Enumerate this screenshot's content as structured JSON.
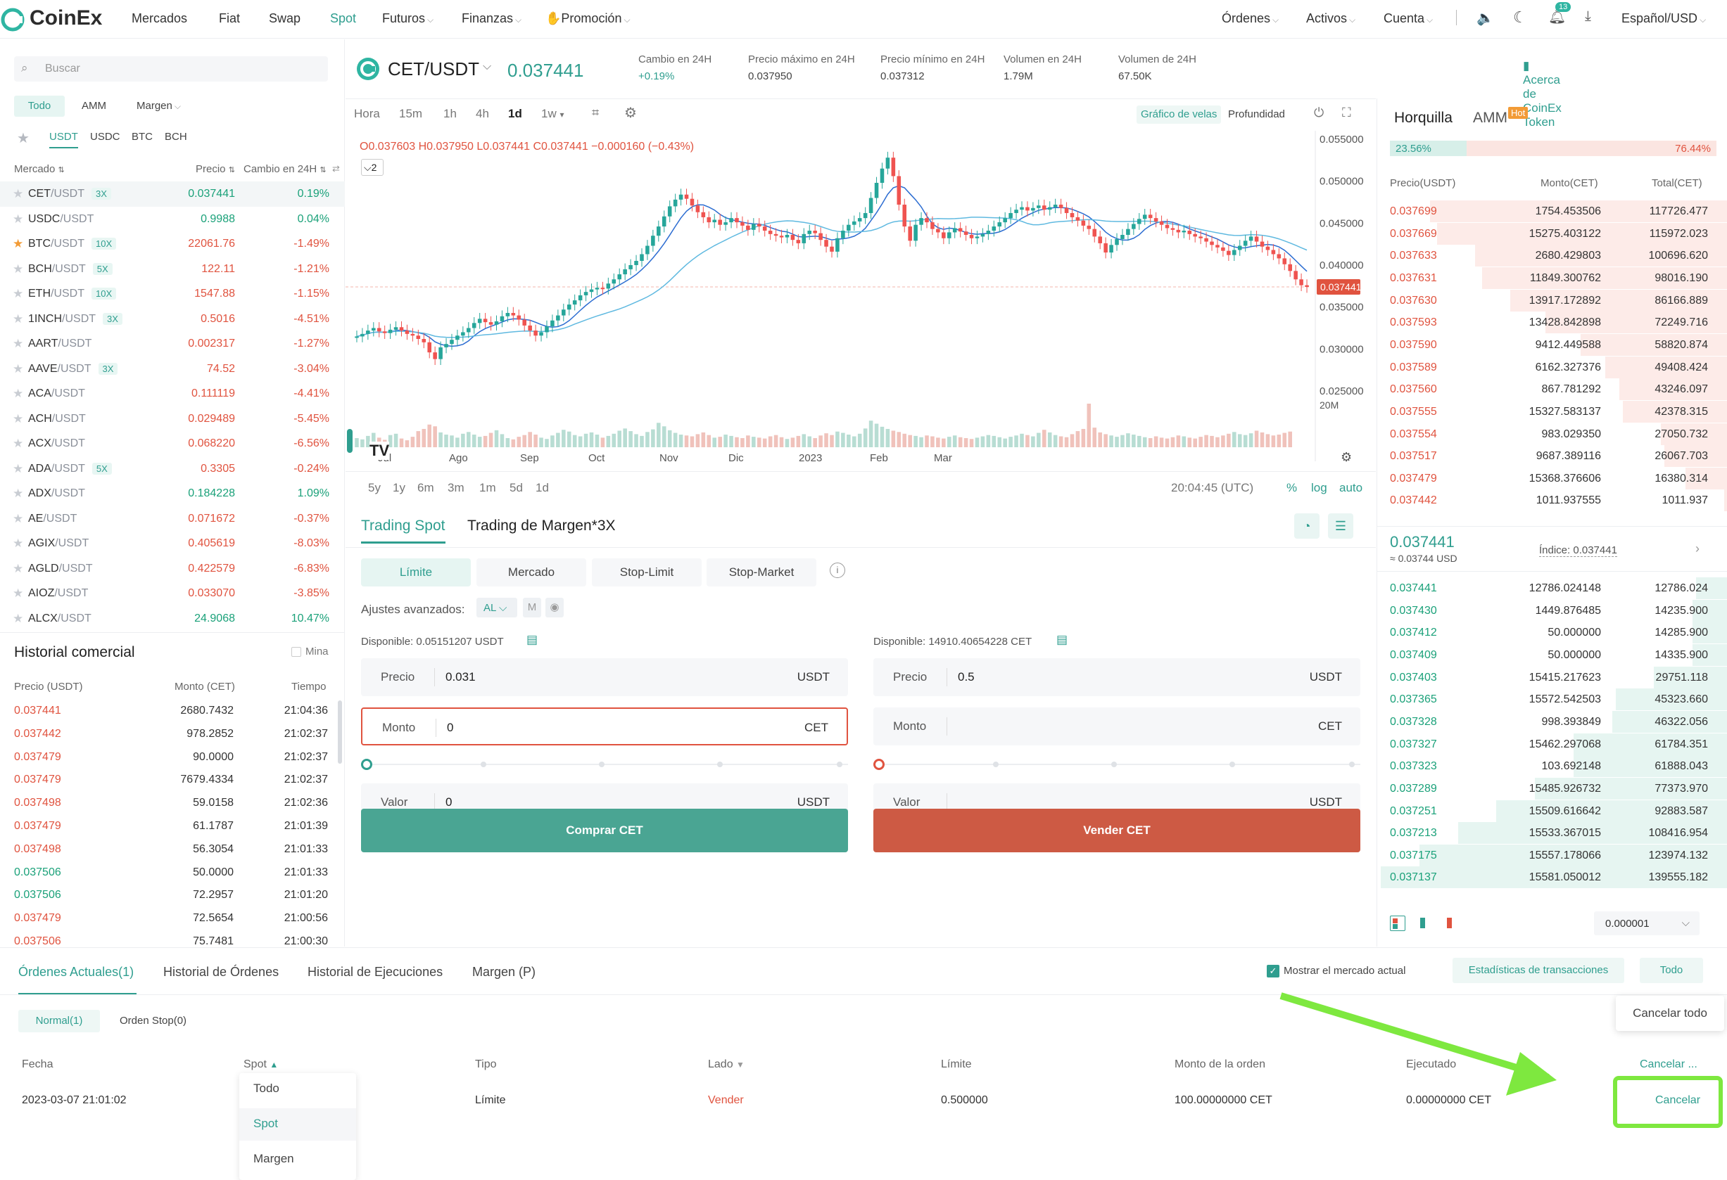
{
  "nav": {
    "brand": "CoinEx",
    "links": [
      "Mercados",
      "Fiat",
      "Swap",
      "Spot",
      "Futuros",
      "Finanzas",
      "Promoción"
    ],
    "right": [
      "Órdenes",
      "Activos",
      "Cuenta",
      "Español/USD"
    ],
    "notif_count": "13"
  },
  "left": {
    "search_placeholder": "Buscar",
    "filters": [
      "Todo",
      "AMM",
      "Margen"
    ],
    "quotes": [
      "USDT",
      "USDC",
      "BTC",
      "BCH"
    ],
    "headers": {
      "market": "Mercado",
      "price": "Precio",
      "change": "Cambio en 24H"
    },
    "markets": [
      {
        "base": "CET",
        "quote": "/USDT",
        "lev": "3X",
        "price": "0.037441",
        "change": "0.19%",
        "up": true
      },
      {
        "base": "USDC",
        "quote": "/USDT",
        "lev": "",
        "price": "0.9988",
        "change": "0.04%",
        "up": true
      },
      {
        "base": "BTC",
        "quote": "/USDT",
        "lev": "10X",
        "price": "22061.76",
        "change": "-1.49%",
        "up": false,
        "fav": true
      },
      {
        "base": "BCH",
        "quote": "/USDT",
        "lev": "5X",
        "price": "122.11",
        "change": "-1.21%",
        "up": false
      },
      {
        "base": "ETH",
        "quote": "/USDT",
        "lev": "10X",
        "price": "1547.88",
        "change": "-1.15%",
        "up": false
      },
      {
        "base": "1INCH",
        "quote": "/USDT",
        "lev": "3X",
        "price": "0.5016",
        "change": "-4.51%",
        "up": false
      },
      {
        "base": "AART",
        "quote": "/USDT",
        "lev": "",
        "price": "0.002317",
        "change": "-1.27%",
        "up": false
      },
      {
        "base": "AAVE",
        "quote": "/USDT",
        "lev": "3X",
        "price": "74.52",
        "change": "-3.04%",
        "up": false
      },
      {
        "base": "ACA",
        "quote": "/USDT",
        "lev": "",
        "price": "0.111119",
        "change": "-4.41%",
        "up": false
      },
      {
        "base": "ACH",
        "quote": "/USDT",
        "lev": "",
        "price": "0.029489",
        "change": "-5.45%",
        "up": false
      },
      {
        "base": "ACX",
        "quote": "/USDT",
        "lev": "",
        "price": "0.068220",
        "change": "-6.56%",
        "up": false
      },
      {
        "base": "ADA",
        "quote": "/USDT",
        "lev": "5X",
        "price": "0.3305",
        "change": "-0.24%",
        "up": false
      },
      {
        "base": "ADX",
        "quote": "/USDT",
        "lev": "",
        "price": "0.184228",
        "change": "1.09%",
        "up": true
      },
      {
        "base": "AE",
        "quote": "/USDT",
        "lev": "",
        "price": "0.071672",
        "change": "-0.37%",
        "up": false
      },
      {
        "base": "AGIX",
        "quote": "/USDT",
        "lev": "",
        "price": "0.405619",
        "change": "-8.03%",
        "up": false
      },
      {
        "base": "AGLD",
        "quote": "/USDT",
        "lev": "",
        "price": "0.422579",
        "change": "-6.83%",
        "up": false
      },
      {
        "base": "AIOZ",
        "quote": "/USDT",
        "lev": "",
        "price": "0.033070",
        "change": "-3.85%",
        "up": false
      },
      {
        "base": "ALCX",
        "quote": "/USDT",
        "lev": "",
        "price": "24.9068",
        "change": "10.47%",
        "up": true
      }
    ],
    "trades_title": "Historial comercial",
    "trades_mina": "Mina",
    "trades_headers": {
      "price": "Precio (USDT)",
      "amount": "Monto (CET)",
      "time": "Tiempo"
    },
    "trades": [
      {
        "p": "0.037441",
        "a": "2680.7432",
        "t": "21:04:36",
        "up": false
      },
      {
        "p": "0.037442",
        "a": "978.2852",
        "t": "21:02:37",
        "up": false
      },
      {
        "p": "0.037479",
        "a": "90.0000",
        "t": "21:02:37",
        "up": false
      },
      {
        "p": "0.037479",
        "a": "7679.4334",
        "t": "21:02:37",
        "up": false
      },
      {
        "p": "0.037498",
        "a": "59.0158",
        "t": "21:02:36",
        "up": false
      },
      {
        "p": "0.037479",
        "a": "61.1787",
        "t": "21:01:39",
        "up": false
      },
      {
        "p": "0.037498",
        "a": "56.3054",
        "t": "21:01:33",
        "up": false
      },
      {
        "p": "0.037506",
        "a": "50.0000",
        "t": "21:01:33",
        "up": true
      },
      {
        "p": "0.037506",
        "a": "72.2957",
        "t": "21:01:20",
        "up": true
      },
      {
        "p": "0.037479",
        "a": "72.5654",
        "t": "21:00:56",
        "up": false
      },
      {
        "p": "0.037506",
        "a": "75.7481",
        "t": "21:00:30",
        "up": false
      }
    ]
  },
  "ticker": {
    "pair": "CET/USDT",
    "price": "0.037441",
    "stats": [
      {
        "label": "Cambio en 24H",
        "value": "+0.19%"
      },
      {
        "label": "Precio máximo en 24H",
        "value": "0.037950"
      },
      {
        "label": "Precio mínimo en 24H",
        "value": "0.037312"
      },
      {
        "label": "Volumen en 24H",
        "value": "1.79M"
      },
      {
        "label": "Volumen de 24H",
        "value": "67.50K"
      }
    ],
    "about": "Acerca de CoinEx Token"
  },
  "chart": {
    "timeframes": [
      "Hora",
      "15m",
      "1h",
      "4h",
      "1d",
      "1w"
    ],
    "views": [
      "Gráfico de velas",
      "Profundidad"
    ],
    "ohlc": "O0.037603 H0.037950 L0.037441 C0.037441 −0.000160 (−0.43%)",
    "indicator_count": "2",
    "range_buttons": [
      "5y",
      "1y",
      "6m",
      "3m",
      "1m",
      "5d",
      "1d"
    ],
    "clock": "20:04:45 (UTC)",
    "axis_opts": [
      "%",
      "log",
      "auto"
    ],
    "vol_label": "20M"
  },
  "chart_data": {
    "type": "candlestick",
    "xlabel": "",
    "ylabel": "",
    "x_ticks": [
      "Jul",
      "Ago",
      "Sep",
      "Oct",
      "Nov",
      "Dic",
      "2023",
      "Feb",
      "Mar"
    ],
    "y_ticks": [
      "0.055000",
      "0.050000",
      "0.045000",
      "0.040000",
      "0.035000",
      "0.030000",
      "0.025000"
    ],
    "ylim": [
      0.025,
      0.056
    ],
    "last_price": "0.037441",
    "close": [
      0.0315,
      0.0318,
      0.0322,
      0.0325,
      0.0321,
      0.0319,
      0.0323,
      0.0326,
      0.0322,
      0.0318,
      0.0316,
      0.0312,
      0.0308,
      0.0296,
      0.0288,
      0.0302,
      0.0306,
      0.0311,
      0.0316,
      0.032,
      0.0325,
      0.0331,
      0.0336,
      0.0332,
      0.0329,
      0.0333,
      0.0339,
      0.0343,
      0.034,
      0.0335,
      0.0328,
      0.0322,
      0.0316,
      0.032,
      0.0327,
      0.0334,
      0.034,
      0.0347,
      0.0353,
      0.0358,
      0.0364,
      0.0368,
      0.0371,
      0.0373,
      0.0372,
      0.0378,
      0.0383,
      0.0389,
      0.0395,
      0.04,
      0.0405,
      0.0413,
      0.0423,
      0.0435,
      0.0446,
      0.0458,
      0.047,
      0.0478,
      0.0484,
      0.0479,
      0.0471,
      0.0463,
      0.0457,
      0.0451,
      0.0454,
      0.0448,
      0.0451,
      0.0456,
      0.0451,
      0.0447,
      0.0442,
      0.0449,
      0.0446,
      0.0441,
      0.0437,
      0.0435,
      0.0433,
      0.0436,
      0.043,
      0.0426,
      0.0437,
      0.0441,
      0.0438,
      0.043,
      0.0422,
      0.0416,
      0.0432,
      0.0441,
      0.0448,
      0.0452,
      0.0456,
      0.0462,
      0.048,
      0.0498,
      0.0515,
      0.0528,
      0.0506,
      0.0472,
      0.0446,
      0.0429,
      0.0448,
      0.0456,
      0.0451,
      0.0443,
      0.0439,
      0.0432,
      0.0439,
      0.0444,
      0.044,
      0.0436,
      0.0432,
      0.0434,
      0.0437,
      0.0441,
      0.0446,
      0.0451,
      0.0456,
      0.0462,
      0.0466,
      0.0469,
      0.0465,
      0.0468,
      0.0471,
      0.0466,
      0.0469,
      0.0472,
      0.0468,
      0.0462,
      0.0457,
      0.0453,
      0.0447,
      0.0443,
      0.0434,
      0.0426,
      0.0415,
      0.0424,
      0.0431,
      0.0436,
      0.0443,
      0.0449,
      0.0455,
      0.046,
      0.0456,
      0.0452,
      0.0448,
      0.0444,
      0.0442,
      0.0439,
      0.0441,
      0.0437,
      0.0434,
      0.0432,
      0.0428,
      0.0424,
      0.0421,
      0.0417,
      0.0412,
      0.0418,
      0.0423,
      0.0429,
      0.0434,
      0.0428,
      0.0422,
      0.0418,
      0.0413,
      0.0408,
      0.0401,
      0.0393,
      0.0383,
      0.0376,
      0.0374
    ],
    "volume": [
      0.21,
      0.18,
      0.26,
      0.33,
      0.22,
      0.17,
      0.28,
      0.31,
      0.2,
      0.16,
      0.24,
      0.37,
      0.42,
      0.52,
      0.48,
      0.34,
      0.29,
      0.27,
      0.22,
      0.31,
      0.35,
      0.29,
      0.24,
      0.26,
      0.33,
      0.39,
      0.3,
      0.21,
      0.18,
      0.24,
      0.28,
      0.35,
      0.29,
      0.22,
      0.19,
      0.27,
      0.33,
      0.4,
      0.36,
      0.28,
      0.25,
      0.31,
      0.34,
      0.29,
      0.22,
      0.26,
      0.31,
      0.38,
      0.43,
      0.37,
      0.3,
      0.26,
      0.35,
      0.41,
      0.56,
      0.48,
      0.39,
      0.33,
      0.29,
      0.27,
      0.25,
      0.3,
      0.34,
      0.28,
      0.22,
      0.24,
      0.29,
      0.26,
      0.23,
      0.21,
      0.27,
      0.24,
      0.22,
      0.2,
      0.25,
      0.28,
      0.23,
      0.19,
      0.22,
      0.26,
      0.3,
      0.25,
      0.21,
      0.27,
      0.32,
      0.28,
      0.36,
      0.33,
      0.29,
      0.25,
      0.31,
      0.43,
      0.61,
      0.54,
      0.47,
      0.42,
      0.38,
      0.35,
      0.31,
      0.28,
      0.26,
      0.23,
      0.27,
      0.25,
      0.22,
      0.2,
      0.24,
      0.27,
      0.23,
      0.21,
      0.19,
      0.22,
      0.25,
      0.28,
      0.26,
      0.23,
      0.2,
      0.24,
      0.27,
      0.31,
      0.28,
      0.25,
      0.33,
      0.4,
      0.34,
      0.28,
      0.25,
      0.23,
      0.3,
      0.37,
      0.42,
      1.0,
      0.45,
      0.34,
      0.3,
      0.27,
      0.24,
      0.28,
      0.32,
      0.29,
      0.26,
      0.23,
      0.21,
      0.25,
      0.22,
      0.2,
      0.23,
      0.27,
      0.25,
      0.22,
      0.2,
      0.24,
      0.28,
      0.26,
      0.23,
      0.27,
      0.31,
      0.35,
      0.3,
      0.28,
      0.32,
      0.38,
      0.34,
      0.3,
      0.27,
      0.29,
      0.33,
      0.36
    ]
  },
  "trade_panel": {
    "tabs": [
      "Trading Spot",
      "Trading de Margen*3X"
    ],
    "order_types": [
      "Límite",
      "Mercado",
      "Stop-Limit",
      "Stop-Market"
    ],
    "advanced_label": "Ajustes avanzados:",
    "advanced_value": "AL",
    "advanced_m": "M",
    "buy": {
      "available": "Disponible: 0.05151207 USDT",
      "price_label": "Precio",
      "price": "0.031",
      "price_unit": "USDT",
      "amount_label": "Monto",
      "amount": "0",
      "amount_unit": "CET",
      "value_label": "Valor",
      "value": "0",
      "value_unit": "USDT",
      "button": "Comprar CET"
    },
    "sell": {
      "available": "Disponible: 14910.40654228 CET",
      "price_label": "Precio",
      "price": "0.5",
      "price_unit": "USDT",
      "amount_label": "Monto",
      "amount": "",
      "amount_unit": "CET",
      "value_label": "Valor",
      "value": "",
      "value_unit": "USDT",
      "button": "Vender CET"
    }
  },
  "orderbook": {
    "tabs": [
      "Horquilla",
      "AMM"
    ],
    "hot": "Hot",
    "buy_pct": "23.56%",
    "sell_pct": "76.44%",
    "buy_ratio": 0.2356,
    "headers": {
      "price": "Precio(USDT)",
      "amount": "Monto(CET)",
      "total": "Total(CET)"
    },
    "asks": [
      {
        "p": "0.037699",
        "m": "1754.453506",
        "t": "117726.477",
        "d": 0.85
      },
      {
        "p": "0.037669",
        "m": "15275.403122",
        "t": "115972.023",
        "d": 0.83
      },
      {
        "p": "0.037633",
        "m": "2680.429803",
        "t": "100696.620",
        "d": 0.72
      },
      {
        "p": "0.037631",
        "m": "11849.300762",
        "t": "98016.190",
        "d": 0.7
      },
      {
        "p": "0.037630",
        "m": "13917.172892",
        "t": "86166.889",
        "d": 0.62
      },
      {
        "p": "0.037593",
        "m": "13428.842898",
        "t": "72249.716",
        "d": 0.52
      },
      {
        "p": "0.037590",
        "m": "9412.449588",
        "t": "58820.874",
        "d": 0.42
      },
      {
        "p": "0.037589",
        "m": "6162.327376",
        "t": "49408.424",
        "d": 0.35
      },
      {
        "p": "0.037560",
        "m": "867.781292",
        "t": "43246.097",
        "d": 0.31
      },
      {
        "p": "0.037555",
        "m": "15327.583137",
        "t": "42378.315",
        "d": 0.3
      },
      {
        "p": "0.037554",
        "m": "983.029350",
        "t": "27050.732",
        "d": 0.19
      },
      {
        "p": "0.037517",
        "m": "9687.389116",
        "t": "26067.703",
        "d": 0.18
      },
      {
        "p": "0.037479",
        "m": "15368.376606",
        "t": "16380.314",
        "d": 0.12
      },
      {
        "p": "0.037442",
        "m": "1011.937555",
        "t": "1011.937",
        "d": 0.01
      }
    ],
    "mid_price": "0.037441",
    "mid_usd": "≈ 0.03744 USD",
    "index": "Índice: 0.037441",
    "bids": [
      {
        "p": "0.037441",
        "m": "12786.024148",
        "t": "12786.024",
        "d": 0.09
      },
      {
        "p": "0.037430",
        "m": "1449.876485",
        "t": "14235.900",
        "d": 0.1
      },
      {
        "p": "0.037412",
        "m": "50.000000",
        "t": "14285.900",
        "d": 0.1
      },
      {
        "p": "0.037409",
        "m": "50.000000",
        "t": "14335.900",
        "d": 0.1
      },
      {
        "p": "0.037403",
        "m": "15415.217623",
        "t": "29751.118",
        "d": 0.21
      },
      {
        "p": "0.037365",
        "m": "15572.542503",
        "t": "45323.660",
        "d": 0.32
      },
      {
        "p": "0.037328",
        "m": "998.393849",
        "t": "46322.056",
        "d": 0.33
      },
      {
        "p": "0.037327",
        "m": "15462.297068",
        "t": "61784.351",
        "d": 0.44
      },
      {
        "p": "0.037323",
        "m": "103.692148",
        "t": "61888.043",
        "d": 0.44
      },
      {
        "p": "0.037289",
        "m": "15485.926732",
        "t": "77373.970",
        "d": 0.55
      },
      {
        "p": "0.037251",
        "m": "15509.616642",
        "t": "92883.587",
        "d": 0.66
      },
      {
        "p": "0.037213",
        "m": "15533.367015",
        "t": "108416.954",
        "d": 0.77
      },
      {
        "p": "0.037175",
        "m": "15557.178066",
        "t": "123974.132",
        "d": 0.88
      },
      {
        "p": "0.037137",
        "m": "15581.050012",
        "t": "139555.182",
        "d": 0.99
      }
    ],
    "precision": "0.000001"
  },
  "bottom": {
    "tabs": [
      "Órdenes Actuales(1)",
      "Historial de Órdenes",
      "Historial de Ejecuciones",
      "Margen (P)"
    ],
    "show_current": "Mostrar el mercado actual",
    "stats_btn": "Estadísticas de transacciones",
    "todo_btn": "Todo",
    "cancel_all_tip": "Cancelar todo",
    "subtabs": [
      "Normal(1)",
      "Orden Stop(0)"
    ],
    "headers": [
      "Fecha",
      "Spot",
      "Tipo",
      "Lado",
      "Límite",
      "Monto de la orden",
      "Ejecutado",
      "Cancelar ..."
    ],
    "dropdown": [
      "Todo",
      "Spot",
      "Margen"
    ],
    "order": {
      "date": "2023-03-07 21:01:02",
      "type": "Límite",
      "side": "Vender",
      "limit": "0.500000",
      "amount": "100.00000000 CET",
      "executed": "0.00000000 CET",
      "action": "Cancelar"
    }
  },
  "colors": {
    "accent": "#2f9e8f",
    "up": "#1aa179",
    "down": "#e0533f",
    "buy_btn": "#4aa593",
    "sell_btn": "#cd5a44",
    "highlight": "#7ee83f"
  }
}
